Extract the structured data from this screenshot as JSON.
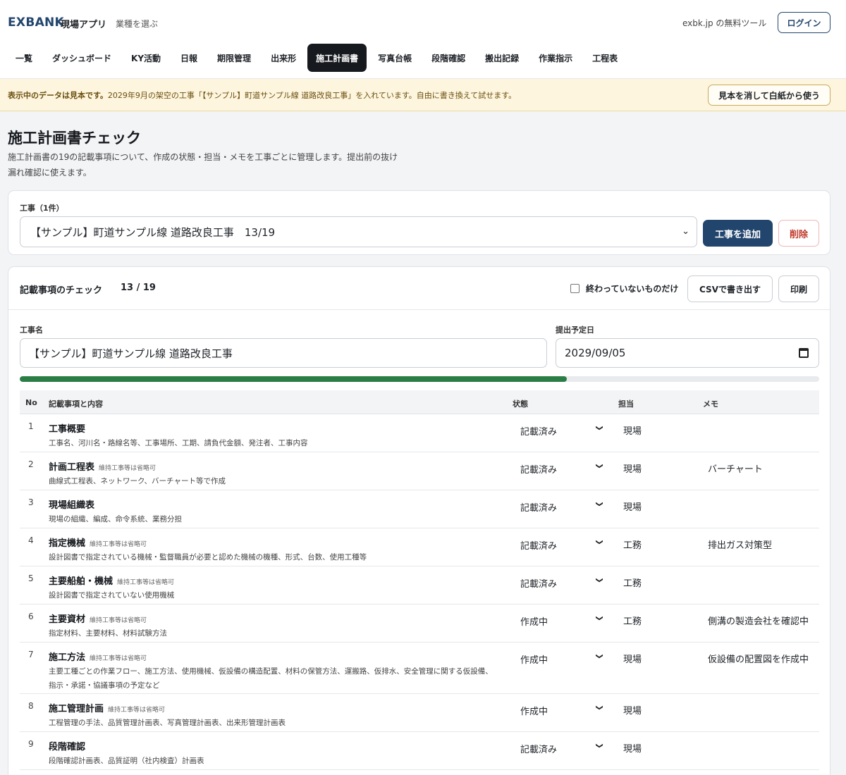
{
  "header": {
    "brand": "EXBANK",
    "app_name": "現場アプリ",
    "industry_link": "業種を選ぶ",
    "free_tool": "exbk.jp の無料ツール",
    "login": "ログイン"
  },
  "nav": {
    "items": [
      {
        "label": "一覧",
        "active": false
      },
      {
        "label": "ダッシュボード",
        "active": false
      },
      {
        "label": "KY活動",
        "active": false
      },
      {
        "label": "日報",
        "active": false
      },
      {
        "label": "期限管理",
        "active": false
      },
      {
        "label": "出来形",
        "active": false
      },
      {
        "label": "施工計画書",
        "active": true
      },
      {
        "label": "写真台帳",
        "active": false
      },
      {
        "label": "段階確認",
        "active": false
      },
      {
        "label": "搬出記録",
        "active": false
      },
      {
        "label": "作業指示",
        "active": false
      },
      {
        "label": "工程表",
        "active": false
      }
    ]
  },
  "banner": {
    "bold": "表示中のデータは見本です。",
    "text": "2029年9月の架空の工事「【サンプル】町道サンプル線 道路改良工事」を入れています。自由に書き換えて試せます。",
    "button": "見本を消して白紙から使う"
  },
  "page": {
    "title": "施工計画書チェック",
    "description": "施工計画書の19の記載事項について、作成の状態・担当・メモを工事ごとに管理します。提出前の抜け漏れ確認に使えます。"
  },
  "project": {
    "label": "工事（1件）",
    "selected": "【サンプル】町道サンプル線 道路改良工事　13/19",
    "add_button": "工事を追加",
    "delete_button": "削除"
  },
  "checklist": {
    "title": "記載事項のチェック",
    "count": "13 / 19",
    "progress": 0.684,
    "filter_label": "終わっていないものだけ",
    "csv_button": "CSVで書き出す",
    "print_button": "印刷",
    "name_label": "工事名",
    "name_value": "【サンプル】町道サンプル線 道路改良工事",
    "date_label": "提出予定日",
    "date_value": "2029/09/05",
    "columns": {
      "no": "No",
      "item": "記載事項と内容",
      "status": "状態",
      "owner": "担当",
      "memo": "メモ"
    },
    "rows": [
      {
        "no": "1",
        "title": "工事概要",
        "tag": "",
        "desc": "工事名、河川名・路線名等、工事場所、工期、請負代金額、発注者、工事内容",
        "status": "記載済み",
        "owner": "現場",
        "memo": ""
      },
      {
        "no": "2",
        "title": "計画工程表",
        "tag": "維持工事等は省略可",
        "desc": "曲線式工程表、ネットワーク、バーチャート等で作成",
        "status": "記載済み",
        "owner": "現場",
        "memo": "バーチャート"
      },
      {
        "no": "3",
        "title": "現場組織表",
        "tag": "",
        "desc": "現場の組織、編成、命令系統、業務分担",
        "status": "記載済み",
        "owner": "現場",
        "memo": ""
      },
      {
        "no": "4",
        "title": "指定機械",
        "tag": "維持工事等は省略可",
        "desc": "設計図書で指定されている機械・監督職員が必要と認めた機械の機種、形式、台数、使用工種等",
        "status": "記載済み",
        "owner": "工務",
        "memo": "排出ガス対策型"
      },
      {
        "no": "5",
        "title": "主要船舶・機械",
        "tag": "維持工事等は省略可",
        "desc": "設計図書で指定されていない使用機械",
        "status": "記載済み",
        "owner": "工務",
        "memo": ""
      },
      {
        "no": "6",
        "title": "主要資材",
        "tag": "維持工事等は省略可",
        "desc": "指定材料、主要材料、材料試験方法",
        "status": "作成中",
        "owner": "工務",
        "memo": "側溝の製造会社を確認中"
      },
      {
        "no": "7",
        "title": "施工方法",
        "tag": "維持工事等は省略可",
        "desc": "主要工種ごとの作業フロー、施工方法、使用機械、仮設備の構造配置、材料の保管方法、運搬路、仮排水、安全管理に関する仮設備、指示・承諾・協議事項の予定など",
        "status": "作成中",
        "owner": "現場",
        "memo": "仮設備の配置図を作成中"
      },
      {
        "no": "8",
        "title": "施工管理計画",
        "tag": "維持工事等は省略可",
        "desc": "工程管理の手法、品質管理計画表、写真管理計画表、出来形管理計画表",
        "status": "作成中",
        "owner": "現場",
        "memo": ""
      },
      {
        "no": "9",
        "title": "段階確認",
        "tag": "",
        "desc": "段階確認計画表、品質証明（社内検査）計画表",
        "status": "記載済み",
        "owner": "現場",
        "memo": ""
      }
    ]
  }
}
